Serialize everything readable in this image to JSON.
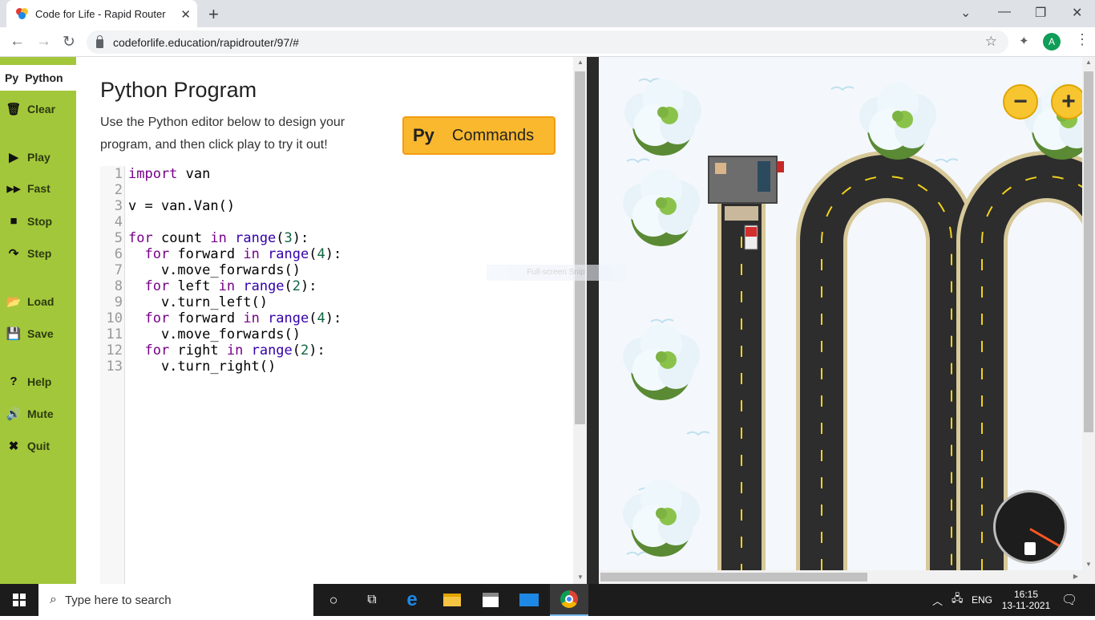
{
  "browser": {
    "tab_title": "Code for Life - Rapid Router",
    "url": "codeforlife.education/rapidrouter/97/#",
    "avatar_letter": "A"
  },
  "sidebar": {
    "tab_label": "Python",
    "tab_prefix": "Py",
    "items": [
      {
        "label": "Clear",
        "icon": "trash-icon"
      },
      {
        "label": "Play",
        "icon": "play-icon"
      },
      {
        "label": "Fast",
        "icon": "fast-forward-icon"
      },
      {
        "label": "Stop",
        "icon": "stop-icon"
      },
      {
        "label": "Step",
        "icon": "step-icon"
      },
      {
        "label": "Load",
        "icon": "folder-icon"
      },
      {
        "label": "Save",
        "icon": "save-icon"
      },
      {
        "label": "Help",
        "icon": "help-icon"
      },
      {
        "label": "Mute",
        "icon": "speaker-icon"
      },
      {
        "label": "Quit",
        "icon": "close-icon"
      }
    ]
  },
  "editor": {
    "title": "Python Program",
    "description": "Use the Python editor below to design your program, and then click play to try it out!",
    "commands_prefix": "Py",
    "commands_label": "Commands",
    "lines": [
      "1",
      "2",
      "3",
      "4",
      "5",
      "6",
      "7",
      "8",
      "9",
      "10",
      "11",
      "12",
      "13"
    ]
  },
  "overlay": {
    "snip_label": "Full-screen Snip"
  },
  "game": {
    "zoom_out_label": "−",
    "zoom_in_label": "+"
  },
  "taskbar": {
    "search_placeholder": "Type here to search",
    "language": "ENG",
    "time": "16:15",
    "date": "13-11-2021"
  }
}
